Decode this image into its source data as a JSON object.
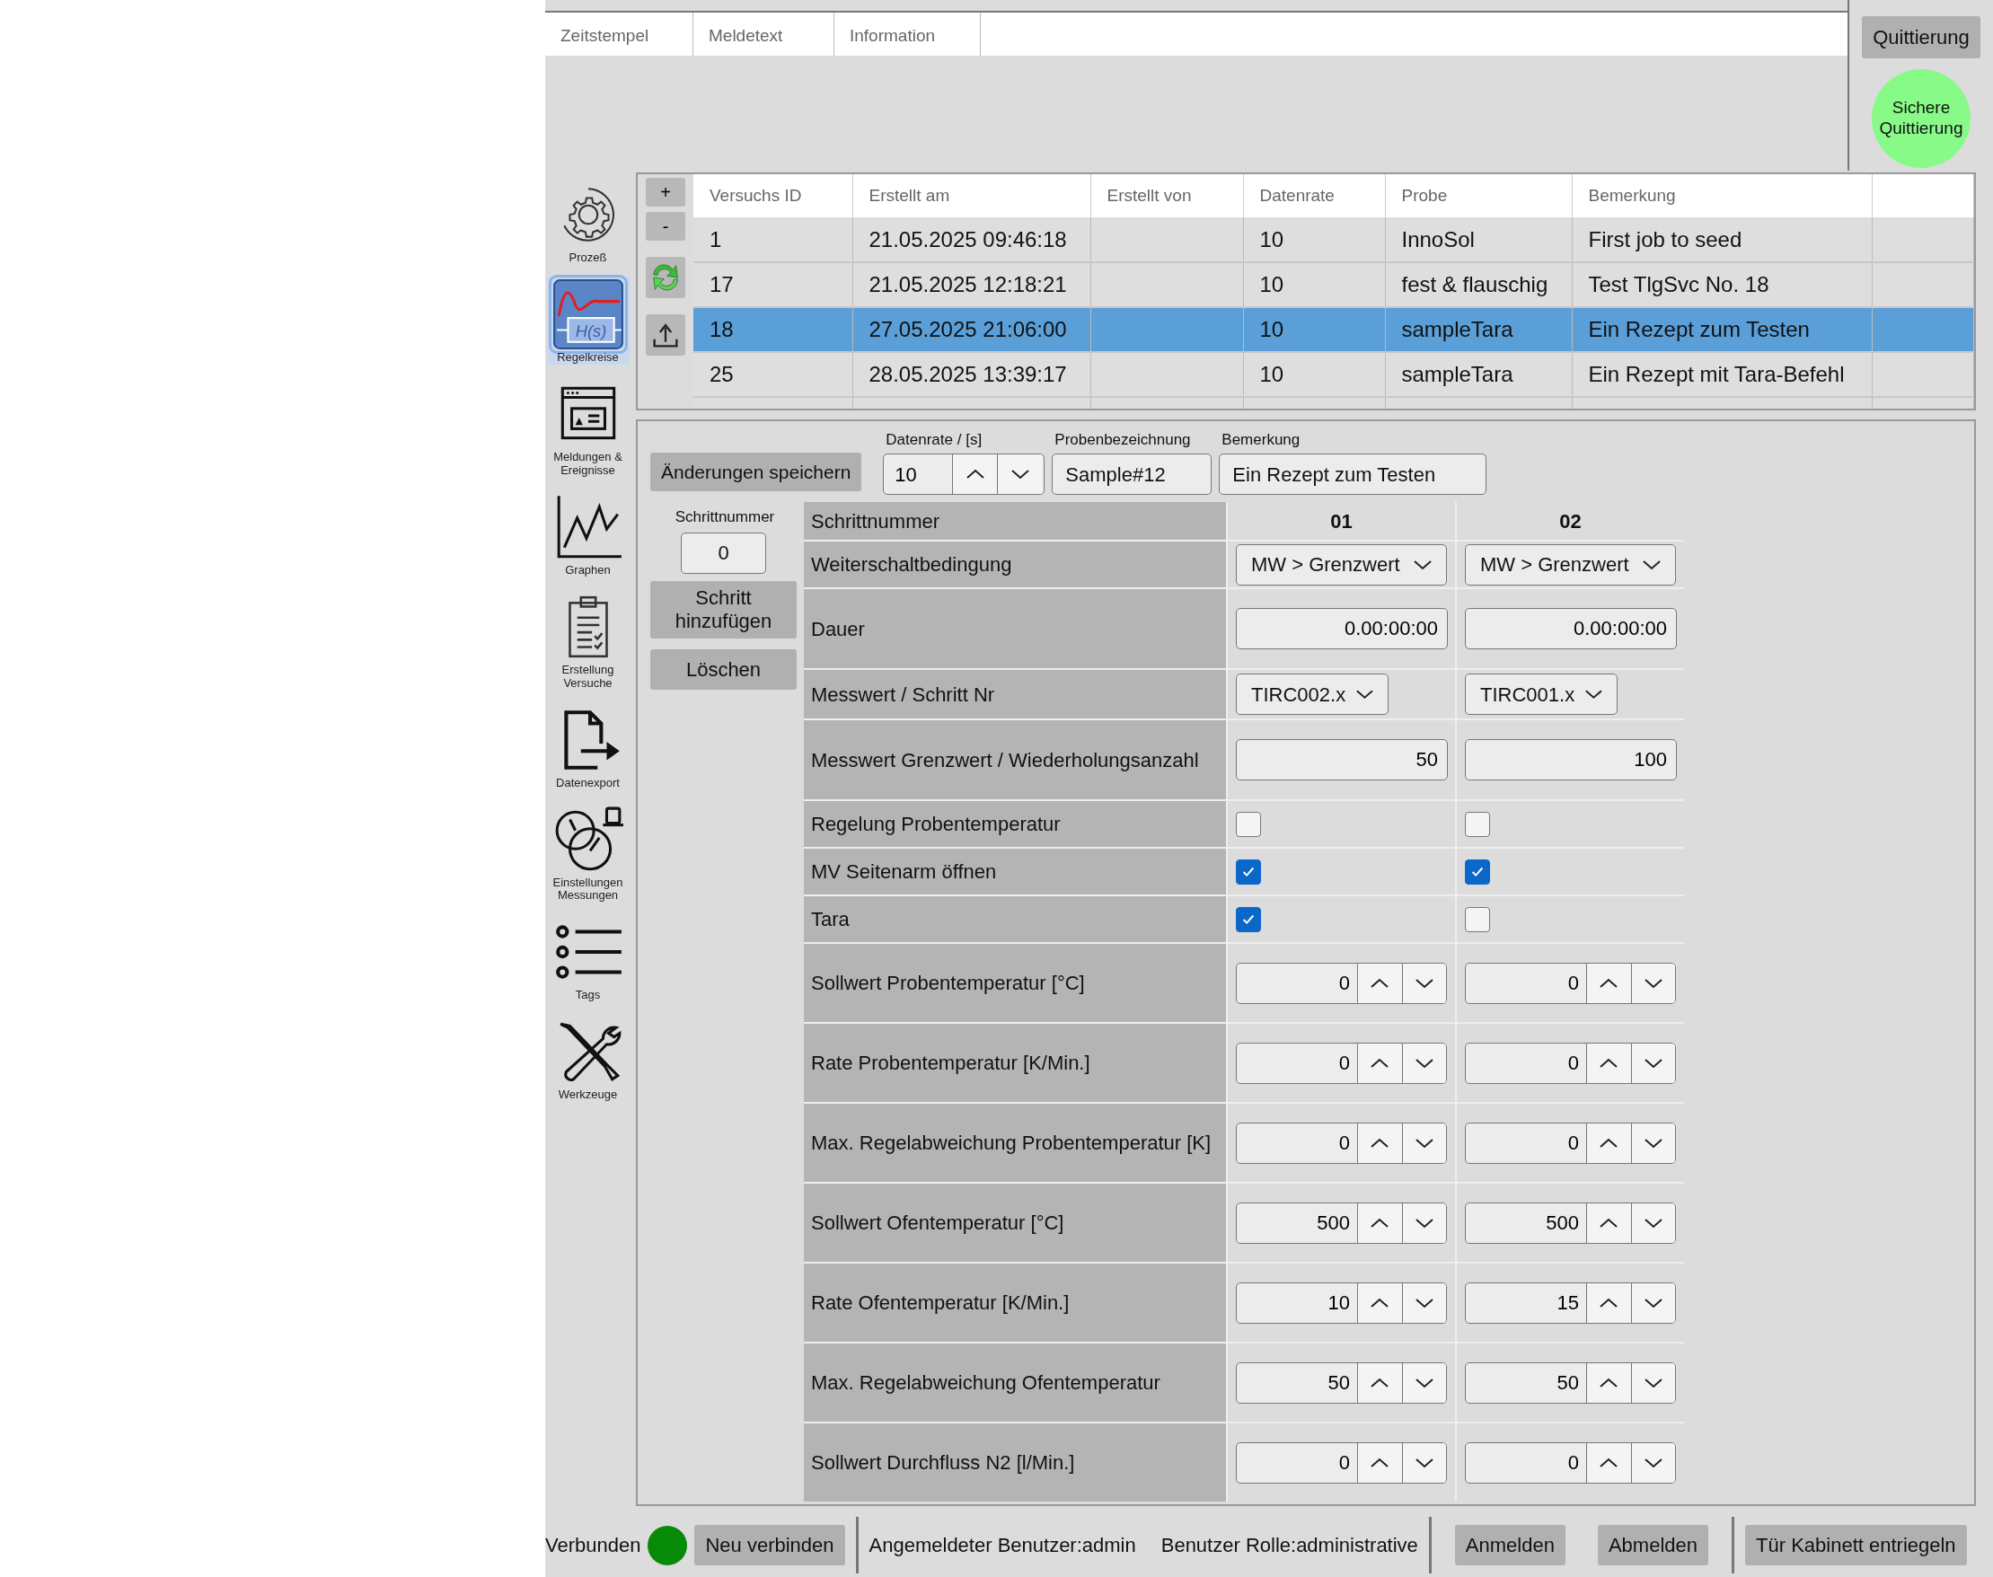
{
  "message_list": {
    "columns": [
      "Zeitstempel",
      "Meldetext",
      "Information"
    ]
  },
  "acknowledge": {
    "button": "Quittierung",
    "safe_button": "Sichere Quittierung"
  },
  "sidebar": {
    "items": [
      {
        "kind": "gear",
        "label": "Prozeß",
        "selected": false
      },
      {
        "kind": "transfer",
        "label": "Regelkreise",
        "icon_text": "H(s)",
        "selected": true
      },
      {
        "kind": "messages",
        "label": "Meldungen & Ereignisse",
        "selected": false
      },
      {
        "kind": "graph",
        "label": "Graphen",
        "selected": false
      },
      {
        "kind": "clipboard",
        "label": "Erstellung Versuche",
        "selected": false
      },
      {
        "kind": "export",
        "label": "Datenexport",
        "selected": false
      },
      {
        "kind": "gauges",
        "label": "Einstellungen Messungen",
        "selected": false
      },
      {
        "kind": "list",
        "label": "Tags",
        "selected": false
      },
      {
        "kind": "tools",
        "label": "Werkzeuge",
        "selected": false
      }
    ]
  },
  "experiments": {
    "side_buttons": [
      "+",
      "-"
    ],
    "columns": [
      "Versuchs ID",
      "Erstellt am",
      "Erstellt von",
      "Datenrate",
      "Probe",
      "Bemerkung"
    ],
    "rows": [
      {
        "cells": [
          "1",
          "21.05.2025 09:46:18",
          "",
          "10",
          "InnoSol",
          "First job to seed"
        ],
        "selected": false
      },
      {
        "cells": [
          "17",
          "21.05.2025 12:18:21",
          "",
          "10",
          "fest & flauschig",
          "Test TlgSvc No. 18"
        ],
        "selected": false
      },
      {
        "cells": [
          "18",
          "27.05.2025 21:06:00",
          "",
          "10",
          "sampleTara",
          "Ein Rezept zum Testen"
        ],
        "selected": true
      },
      {
        "cells": [
          "25",
          "28.05.2025 13:39:17",
          "",
          "10",
          "sampleTara",
          "Ein Rezept mit Tara-Befehl"
        ],
        "selected": false
      }
    ]
  },
  "editor": {
    "save_button": "Änderungen speichern",
    "data_rate": {
      "label": "Datenrate / [s]",
      "value": "10"
    },
    "sample_name": {
      "label": "Probenbezeichnung",
      "value": "Sample#12"
    },
    "remark": {
      "label": "Bemerkung",
      "value": "Ein Rezept zum Testen"
    },
    "step_number": {
      "label": "Schrittnummer",
      "value": "0"
    },
    "add_step_button": "Schritt hinzufügen",
    "delete_button": "Löschen",
    "steps": {
      "header_label": "Schrittnummer",
      "columns": [
        "01",
        "02"
      ],
      "rows": [
        {
          "label": "Weiterschaltbedingung",
          "kind": "dropdown",
          "cells": [
            "MW > Grenzwert",
            "MW > Grenzwert"
          ]
        },
        {
          "label": "Dauer",
          "kind": "text",
          "cells": [
            "0.00:00:00",
            "0.00:00:00"
          ]
        },
        {
          "label": "Messwert / Schritt Nr",
          "kind": "combo",
          "cells": [
            "TIRC002.x",
            "TIRC001.x"
          ]
        },
        {
          "label": "Messwert Grenzwert / Wiederholungsanzahl",
          "kind": "text",
          "cells": [
            "50",
            "100"
          ]
        },
        {
          "label": "Regelung Probentemperatur",
          "kind": "checkbox",
          "cells": [
            {
              "checked": false
            },
            {
              "checked": false
            }
          ]
        },
        {
          "label": "MV Seitenarm öffnen",
          "kind": "checkbox",
          "cells": [
            {
              "checked": true
            },
            {
              "checked": true
            }
          ]
        },
        {
          "label": "Tara",
          "kind": "checkbox",
          "cells": [
            {
              "checked": true
            },
            {
              "checked": false
            }
          ]
        },
        {
          "label": "Sollwert Probentemperatur [°C]",
          "kind": "spin",
          "cells": [
            "0",
            "0"
          ]
        },
        {
          "label": "Rate Probentemperatur [K/Min.]",
          "kind": "spin",
          "cells": [
            "0",
            "0"
          ]
        },
        {
          "label": "Max. Regelabweichung Probentemperatur [K]",
          "kind": "spin",
          "cells": [
            "0",
            "0"
          ]
        },
        {
          "label": "Sollwert Ofentemperatur [°C]",
          "kind": "spin",
          "cells": [
            "500",
            "500"
          ]
        },
        {
          "label": "Rate Ofentemperatur [K/Min.]",
          "kind": "spin",
          "cells": [
            "10",
            "15"
          ]
        },
        {
          "label": "Max. Regelabweichung Ofentemperatur",
          "kind": "spin",
          "cells": [
            "50",
            "50"
          ]
        },
        {
          "label": "Sollwert Durchfluss N2 [l/Min.]",
          "kind": "spin",
          "cells": [
            "0",
            "0"
          ]
        }
      ]
    }
  },
  "status_bar": {
    "connection_label": "Verbunden",
    "connected": true,
    "reconnect_button": "Neu verbinden",
    "user": "Angemeldeter Benutzer:admin",
    "role": "Benutzer Rolle:administrative",
    "buttons": [
      "Anmelden",
      "Abmelden"
    ],
    "door_button": "Tür Kabinett entriegeln"
  }
}
